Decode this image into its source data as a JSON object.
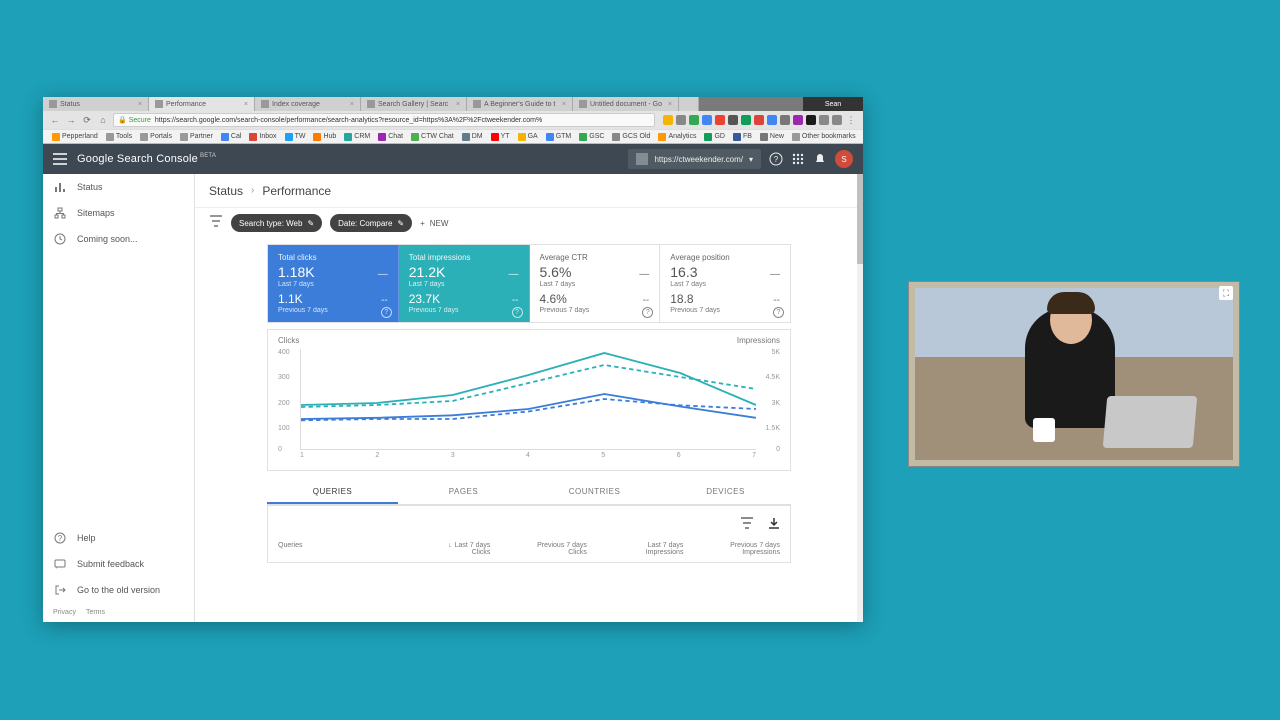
{
  "browser": {
    "tabs": [
      {
        "title": "Status",
        "active": false
      },
      {
        "title": "Performance",
        "active": true
      },
      {
        "title": "Index coverage",
        "active": false
      },
      {
        "title": "Search Gallery | Searc",
        "active": false
      },
      {
        "title": "A Beginner's Guide to t",
        "active": false
      },
      {
        "title": "Untitled document - Go",
        "active": false
      }
    ],
    "user": "Sean",
    "secure_label": "Secure",
    "url": "https://search.google.com/search-console/performance/search-analytics?resource_id=https%3A%2F%2Fctweekender.com%",
    "bookmarks": [
      "Pepperland",
      "Tools",
      "Portals",
      "Partner",
      "Cal",
      "Inbox",
      "TW",
      "Hub",
      "CRM",
      "Chat",
      "CTW Chat",
      "DM",
      "YT",
      "GA",
      "GTM",
      "GSC",
      "GCS Old",
      "Analytics",
      "GD",
      "FB",
      "New"
    ],
    "other_bookmarks": "Other bookmarks"
  },
  "app": {
    "title": "Google Search Console",
    "beta": "BETA",
    "site": "https://ctweekender.com/",
    "avatar_letter": "S"
  },
  "sidebar": {
    "items": [
      {
        "icon": "bar",
        "label": "Status"
      },
      {
        "icon": "sitemap",
        "label": "Sitemaps"
      },
      {
        "icon": "clock",
        "label": "Coming soon..."
      }
    ],
    "footer": [
      {
        "icon": "help",
        "label": "Help"
      },
      {
        "icon": "feedback",
        "label": "Submit feedback"
      },
      {
        "icon": "exit",
        "label": "Go to the old version"
      }
    ],
    "links": {
      "privacy": "Privacy",
      "terms": "Terms"
    }
  },
  "breadcrumb": {
    "root": "Status",
    "current": "Performance"
  },
  "filters": {
    "chip1": "Search type: Web",
    "chip2": "Date: Compare",
    "new": "NEW"
  },
  "metrics": [
    {
      "label": "Total clicks",
      "val": "1.18K",
      "delta": "—",
      "sub": "Last 7 days",
      "val2": "1.1K",
      "delta2": "--",
      "sub2": "Previous 7 days",
      "color": "blue"
    },
    {
      "label": "Total impressions",
      "val": "21.2K",
      "delta": "—",
      "sub": "Last 7 days",
      "val2": "23.7K",
      "delta2": "--",
      "sub2": "Previous 7 days",
      "color": "teal"
    },
    {
      "label": "Average CTR",
      "val": "5.6%",
      "delta": "—",
      "sub": "Last 7 days",
      "val2": "4.6%",
      "delta2": "--",
      "sub2": "Previous 7 days",
      "color": "plain"
    },
    {
      "label": "Average position",
      "val": "16.3",
      "delta": "—",
      "sub": "Last 7 days",
      "val2": "18.8",
      "delta2": "--",
      "sub2": "Previous 7 days",
      "color": "plain"
    }
  ],
  "chart": {
    "left_label": "Clicks",
    "right_label": "Impressions",
    "y_left": [
      "400",
      "300",
      "200",
      "100",
      "0"
    ],
    "y_right": [
      "5K",
      "4.5K",
      "3K",
      "1.5K",
      "0"
    ],
    "x": [
      "1",
      "2",
      "3",
      "4",
      "5",
      "6",
      "7"
    ]
  },
  "chart_data": {
    "type": "line",
    "title": "",
    "xlabel": "",
    "ylabel_left": "Clicks",
    "ylabel_right": "Impressions",
    "x": [
      1,
      2,
      3,
      4,
      5,
      6,
      7
    ],
    "ylim_left": [
      0,
      400
    ],
    "ylim_right": [
      0,
      5000
    ],
    "series": [
      {
        "name": "Clicks — Last 7 days",
        "axis": "left",
        "style": "solid",
        "color": "#3b7dd8",
        "values": [
          120,
          125,
          135,
          160,
          220,
          170,
          125
        ]
      },
      {
        "name": "Clicks — Previous 7 days",
        "axis": "left",
        "style": "dashed",
        "color": "#3b7dd8",
        "values": [
          115,
          120,
          120,
          150,
          200,
          175,
          160
        ]
      },
      {
        "name": "Impressions — Last 7 days",
        "axis": "right",
        "style": "solid",
        "color": "#2cb0b8",
        "values": [
          2200,
          2300,
          2700,
          3700,
          4800,
          3800,
          2200
        ]
      },
      {
        "name": "Impressions — Previous 7 days",
        "axis": "right",
        "style": "dashed",
        "color": "#2cb0b8",
        "values": [
          2100,
          2200,
          2400,
          3300,
          4200,
          3600,
          3000
        ]
      }
    ]
  },
  "data_tabs": [
    "QUERIES",
    "PAGES",
    "COUNTRIES",
    "DEVICES"
  ],
  "table": {
    "col_queries": "Queries",
    "cols": [
      {
        "line1": "Last 7 days",
        "line2": "Clicks",
        "sort": true
      },
      {
        "line1": "Previous 7 days",
        "line2": "Clicks"
      },
      {
        "line1": "Last 7 days",
        "line2": "Impressions"
      },
      {
        "line1": "Previous 7 days",
        "line2": "Impressions"
      }
    ]
  },
  "colors": {
    "blue": "#3b7dd8",
    "teal": "#2cb0b8"
  }
}
